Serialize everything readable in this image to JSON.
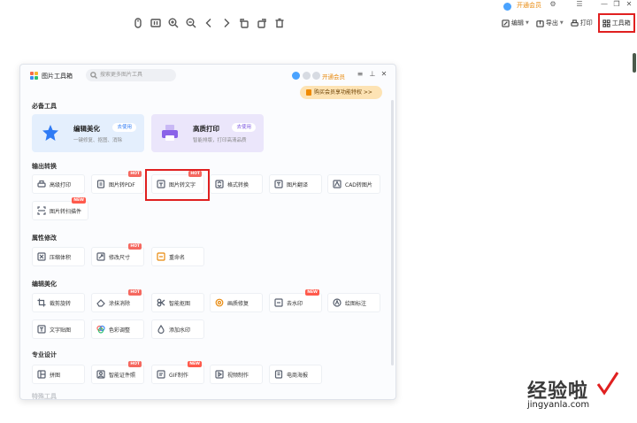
{
  "titlebar": {
    "vip_label": "开通会员",
    "window_controls": [
      "minimize-icon",
      "maximize-icon",
      "close-icon"
    ]
  },
  "viewer_toolbar": {
    "icons": [
      "mouse-icon",
      "actual-size-icon",
      "zoom-in-icon",
      "zoom-out-icon",
      "previous-icon",
      "next-icon",
      "rotate-left-icon",
      "rotate-right-icon",
      "delete-icon"
    ]
  },
  "right_toolbar": {
    "edit_label": "编辑",
    "export_label": "导出",
    "print_label": "打印",
    "toolbox_label": "工具箱"
  },
  "panel": {
    "title": "图片工具箱",
    "search_placeholder": "搜索更多图片工具",
    "vip_label": "开通会员",
    "promo": "购买会员享功能特权 >>",
    "sections": {
      "essential": "必备工具",
      "output": "输出转换",
      "attributes": "属性修改",
      "editing": "编辑美化",
      "professional": "专业设计",
      "more": "特殊工具"
    },
    "big_cards": [
      {
        "title": "编辑美化",
        "subtitle": "一键修复、抠图、消除",
        "button": "去使用"
      },
      {
        "title": "高质打印",
        "subtitle": "智能排版，打印高清品质",
        "button": "去使用"
      }
    ],
    "output_tools": [
      {
        "label": "高级打印",
        "badge": ""
      },
      {
        "label": "图片转PDF",
        "badge": "HOT"
      },
      {
        "label": "图片转文字",
        "badge": "HOT"
      },
      {
        "label": "格式转换",
        "badge": ""
      },
      {
        "label": "图片翻译",
        "badge": ""
      },
      {
        "label": "CAD转图片",
        "badge": ""
      },
      {
        "label": "图片转扫描件",
        "badge": "NEW"
      }
    ],
    "attribute_tools": [
      {
        "label": "压缩体积",
        "badge": ""
      },
      {
        "label": "修改尺寸",
        "badge": "HOT"
      },
      {
        "label": "重命名",
        "badge": ""
      }
    ],
    "editing_tools": [
      {
        "label": "裁剪旋转",
        "badge": ""
      },
      {
        "label": "涂抹消除",
        "badge": "HOT"
      },
      {
        "label": "智能抠图",
        "badge": ""
      },
      {
        "label": "画质修复",
        "badge": ""
      },
      {
        "label": "去水印",
        "badge": "NEW"
      },
      {
        "label": "绘图标注",
        "badge": ""
      },
      {
        "label": "文字贴图",
        "badge": ""
      },
      {
        "label": "色彩调整",
        "badge": ""
      },
      {
        "label": "添加水印",
        "badge": ""
      }
    ],
    "design_tools": [
      {
        "label": "拼图",
        "badge": ""
      },
      {
        "label": "智能证件照",
        "badge": "HOT"
      },
      {
        "label": "GIF制作",
        "badge": "NEW"
      },
      {
        "label": "视频制作",
        "badge": ""
      },
      {
        "label": "电商海报",
        "badge": ""
      }
    ]
  },
  "watermark": {
    "main": "经验啦",
    "url": "jingyanla.com"
  },
  "colors": {
    "accent_blue": "#2f7bf5",
    "vip_orange": "#e8890c",
    "highlight_red": "#e02020"
  }
}
